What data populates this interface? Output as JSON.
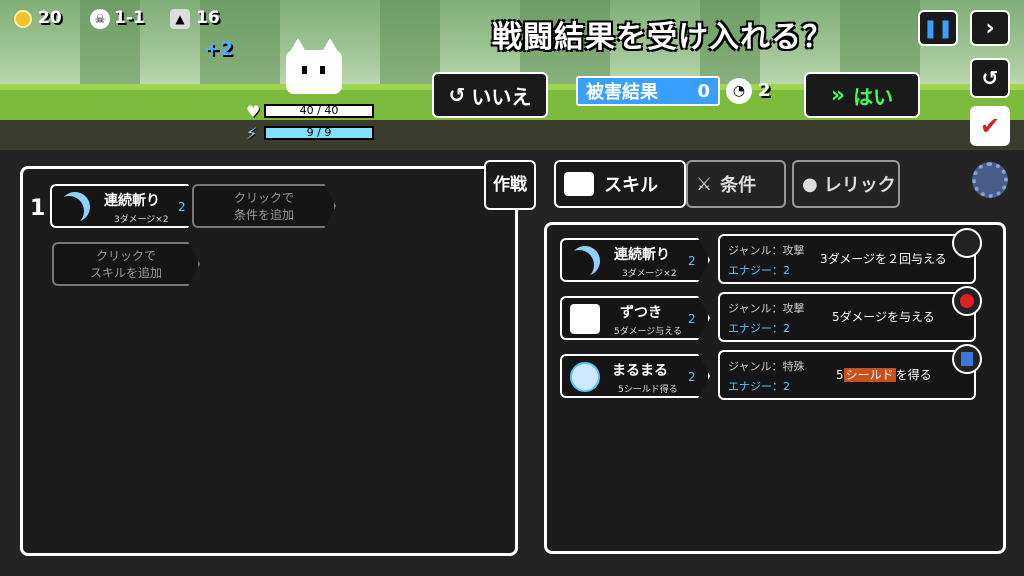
{
  "hud": {
    "coins": "20",
    "stage": "1-1",
    "cats": "16",
    "cats_gain": "+2"
  },
  "prompt": "戦闘結果を受け入れる？",
  "player": {
    "hp": "40 / 40",
    "energy": "9 / 9"
  },
  "dialog": {
    "no_label": "いいえ",
    "damage_label": "被害結果",
    "damage_value": "0",
    "count_value": "2",
    "yes_label": "はい"
  },
  "tactics": {
    "button_label": "作戦",
    "row_number": "1",
    "slot_skill": {
      "name": "連続斬り",
      "sub": "3ダメージ×2",
      "energy": "2"
    },
    "slot_condition_add": "クリックで\n条件を追加",
    "slot_skill_add": "クリックで\nスキルを追加"
  },
  "tabs": {
    "skill": "スキル",
    "condition": "条件",
    "relic": "レリック"
  },
  "skills": [
    {
      "name": "連続斬り",
      "sub": "3ダメージ×2",
      "energy": "2",
      "genre": "ジャンル：攻撃",
      "cost": "エナジー：2",
      "desc": "3ダメージを２回与える"
    },
    {
      "name": "ずつき",
      "sub": "5ダメージ与える",
      "energy": "2",
      "genre": "ジャンル：攻撃",
      "cost": "エナジー：2",
      "desc": "5ダメージを与える"
    },
    {
      "name": "まるまる",
      "sub": "5シールド得る",
      "energy": "2",
      "genre": "ジャンル：特殊",
      "cost": "エナジー：2",
      "desc_num": "5",
      "desc_kw": "シールド",
      "desc_rest": "を得る"
    }
  ],
  "colors": {
    "accent_blue": "#3aa0ff",
    "yes_green": "#3cff5a",
    "hp_white": "#ffffff",
    "energy_cyan": "#7fe0ff",
    "shield_orange": "#c8501e"
  }
}
